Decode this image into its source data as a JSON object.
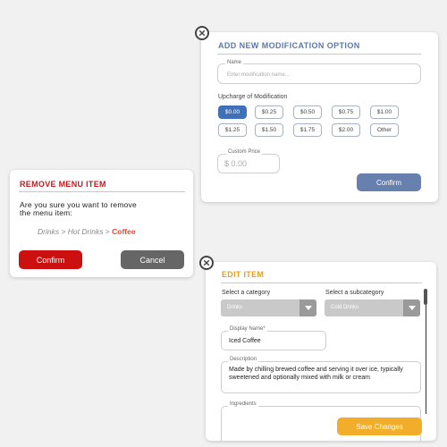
{
  "add_modification": {
    "title": "ADD NEW MODIFICATION OPTION",
    "name_label": "Name",
    "name_placeholder": "Enter modification name...",
    "upcharge_label": "Upcharge of Modification",
    "prices_row1": [
      "$0.00",
      "$0.25",
      "$0.50",
      "$0.75",
      "$1.00"
    ],
    "prices_row2": [
      "$1.25",
      "$1.50",
      "$1.75",
      "$2.00",
      "Other"
    ],
    "selected_price": "$0.00",
    "custom_price_label": "Custom Price",
    "custom_price_placeholder": "$ 0.00",
    "confirm_label": "Confirm",
    "colors": {
      "title": "#5a79a8",
      "selected_chip": "#4070b5",
      "confirm_button": "#6880ad"
    }
  },
  "remove_menu_item": {
    "title": "REMOVE MENU ITEM",
    "question_line1": "Are you sure you want to remove",
    "question_line2": "the menu item:",
    "path_prefix": "Drinks > Hot Drinks > ",
    "path_item": "Coffee",
    "confirm_label": "Confirm",
    "cancel_label": "Cancel",
    "colors": {
      "title": "#c21a1a",
      "confirm_button": "#cc1010",
      "cancel_button": "#666666",
      "item": "#e04a3a"
    }
  },
  "edit_item": {
    "title": "EDIT ITEM",
    "category_label": "Select a category",
    "category_value": "Drinks",
    "subcategory_label": "Select a subcategory",
    "subcategory_value": "Cold Drinks",
    "display_name_label": "Display Name*",
    "display_name_value": "Iced Coffee",
    "description_label": "Description",
    "description_value": "Made by chilling brewed coffee and serving it over ice, typically sweetened and optionally mixed with milk or cream",
    "ingredients_label": "Ingredients",
    "save_label": "Save Changes",
    "colors": {
      "title": "#e6a020",
      "save_button": "#f2ad2a"
    }
  },
  "icons": {
    "close": "close-circle-icon",
    "dropdown": "chevron-down-icon"
  }
}
